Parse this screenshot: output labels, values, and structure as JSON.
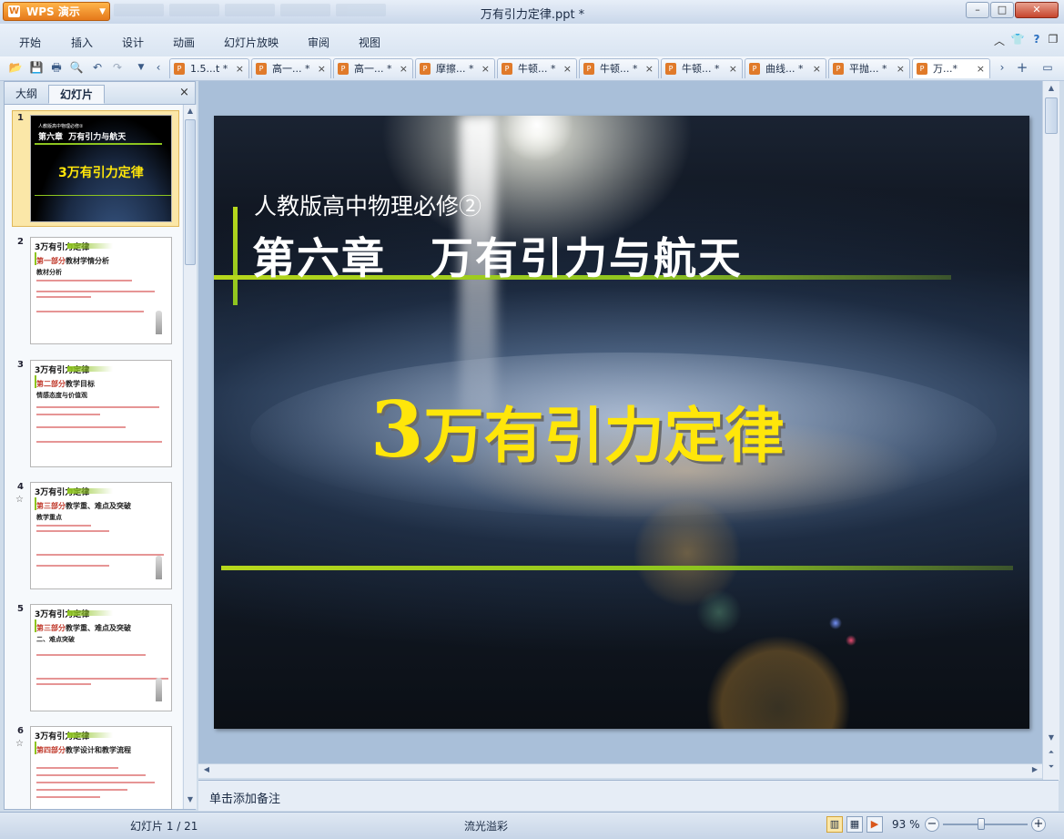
{
  "app": {
    "button_label": "WPS 演示",
    "window_title": "万有引力定律.ppt *"
  },
  "window_controls": {
    "minimize": "–",
    "maximize": "□",
    "close": "✕"
  },
  "menu": {
    "items": [
      "开始",
      "插入",
      "设计",
      "动画",
      "幻灯片放映",
      "审阅",
      "视图"
    ],
    "right_icons": [
      "chevron-up-icon",
      "shirt-icon",
      "help-icon",
      "restore-icon"
    ]
  },
  "toolbar": {
    "icons": [
      "open-icon",
      "save-icon",
      "print-icon",
      "print-preview-icon",
      "undo-icon",
      "redo-icon",
      "customize-icon",
      "tabs-left-icon"
    ],
    "doc_tabs": [
      {
        "label": "1.5...t *",
        "close": "×"
      },
      {
        "label": "高一... *",
        "close": "×"
      },
      {
        "label": "高一... *",
        "close": "×"
      },
      {
        "label": "摩擦... *",
        "close": "×"
      },
      {
        "label": "牛顿... *",
        "close": "×"
      },
      {
        "label": "牛顿... *",
        "close": "×"
      },
      {
        "label": "牛顿... *",
        "close": "×"
      },
      {
        "label": "曲线... *",
        "close": "×"
      },
      {
        "label": "平抛... *",
        "close": "×"
      },
      {
        "label": "万...*",
        "close": "×"
      }
    ],
    "right_icons": [
      "tabs-right-icon",
      "new-tab-icon",
      "tab-list-icon"
    ]
  },
  "left_pane": {
    "tabs": [
      "大纲",
      "幻灯片"
    ],
    "close": "×",
    "thumbnails": [
      {
        "num": "1",
        "small": "人教版高中物理必修②",
        "chapter": "第六章  万有引力与航天",
        "title": "3万有引力定律"
      },
      {
        "num": "2",
        "title": "3万有引力定律",
        "sec_prefix": "第一部分",
        "sec": "教材学情分析",
        "sub": "教材分析",
        "star": ""
      },
      {
        "num": "3",
        "title": "3万有引力定律",
        "sec_prefix": "第二部分",
        "sec": "教学目标",
        "sub": "情感态度与价值观",
        "star": ""
      },
      {
        "num": "4",
        "title": "3万有引力定律",
        "sec_prefix": "第三部分",
        "sec": "教学重、难点及突破",
        "sub": "教学重点",
        "star": "☆"
      },
      {
        "num": "5",
        "title": "3万有引力定律",
        "sec_prefix": "第三部分",
        "sec": "教学重、难点及突破",
        "sub": "二、难点突破",
        "star": ""
      },
      {
        "num": "6",
        "title": "3万有引力定律",
        "sec_prefix": "第四部分",
        "sec": "教学设计和教学流程",
        "sub": "",
        "star": "☆"
      }
    ]
  },
  "slide": {
    "subtitle": "人教版高中物理必修②",
    "chapter": "第六章　万有引力与航天",
    "title_num": "3",
    "title_text": "万有引力定律"
  },
  "notes": {
    "placeholder": "单击添加备注"
  },
  "status": {
    "slide_info": "幻灯片 1 / 21",
    "theme": "流光溢彩",
    "zoom": "93 %",
    "zoom_out": "−",
    "zoom_in": "+",
    "zoom_fraction": 0.45
  }
}
